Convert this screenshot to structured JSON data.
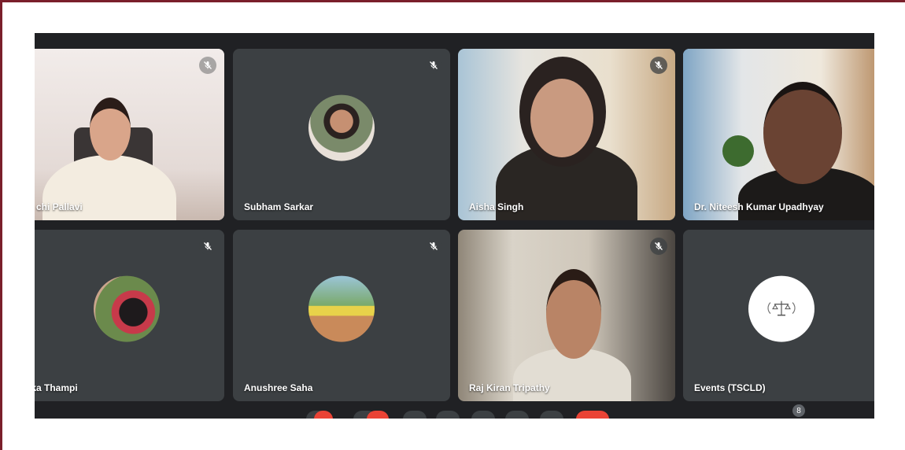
{
  "participants": [
    {
      "name": "chi Pallavi",
      "muted": true
    },
    {
      "name": "Subham Sarkar",
      "muted": true
    },
    {
      "name": "Aisha Singh",
      "muted": true
    },
    {
      "name": "Dr. Niteesh Kumar Upadhyay",
      "muted": false,
      "active": true
    },
    {
      "name": "ika Thampi",
      "muted": true
    },
    {
      "name": "Anushree Saha",
      "muted": true
    },
    {
      "name": "Raj Kiran Tripathy",
      "muted": true
    },
    {
      "name": "Events (TSCLD)",
      "muted": false
    }
  ],
  "toolbar": {
    "participant_count": "8"
  },
  "colors": {
    "tile_bg": "#3c4043",
    "meet_bg": "#202124",
    "active_border": "#8ab4f8",
    "border_accent": "#7a1f2b",
    "end_call": "#ea4335"
  },
  "icons": {
    "mute": "mic-off-icon",
    "people": "people-icon"
  }
}
